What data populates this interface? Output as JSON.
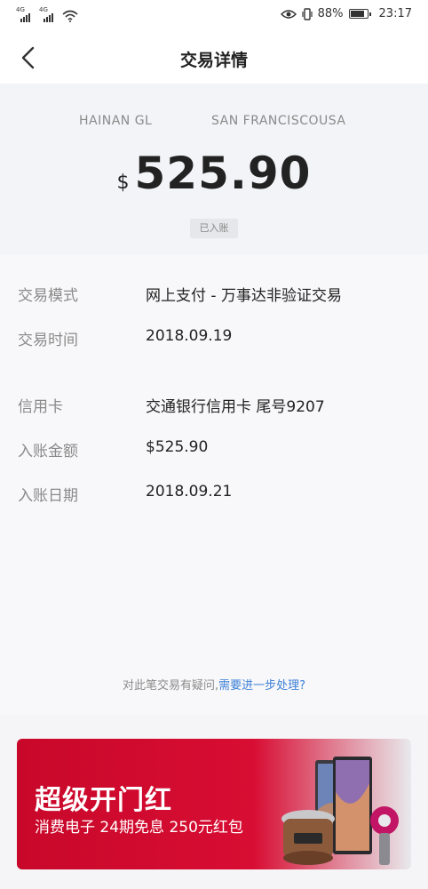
{
  "status_bar": {
    "net1": "4G",
    "net2": "4G",
    "battery": "88%",
    "time": "23:17"
  },
  "nav": {
    "title": "交易详情"
  },
  "hero": {
    "merchant_name": "HAINAN GL",
    "merchant_location": "SAN FRANCISCOUSA",
    "currency_symbol": "$",
    "amount": "525.90",
    "status": "已入账"
  },
  "details": [
    {
      "label": "交易模式",
      "value": "网上支付 - 万事达非验证交易"
    },
    {
      "label": "交易时间",
      "value": "2018.09.19"
    },
    {
      "label": "信用卡",
      "value": "交通银行信用卡 尾号9207"
    },
    {
      "label": "入账金额",
      "value": "$525.90"
    },
    {
      "label": "入账日期",
      "value": "2018.09.21"
    }
  ],
  "question": {
    "text": "对此笔交易有疑问,",
    "link": "需要进一步处理?"
  },
  "banner": {
    "title": "超级开门红",
    "subtitle": "消费电子 24期免息 250元红包"
  }
}
